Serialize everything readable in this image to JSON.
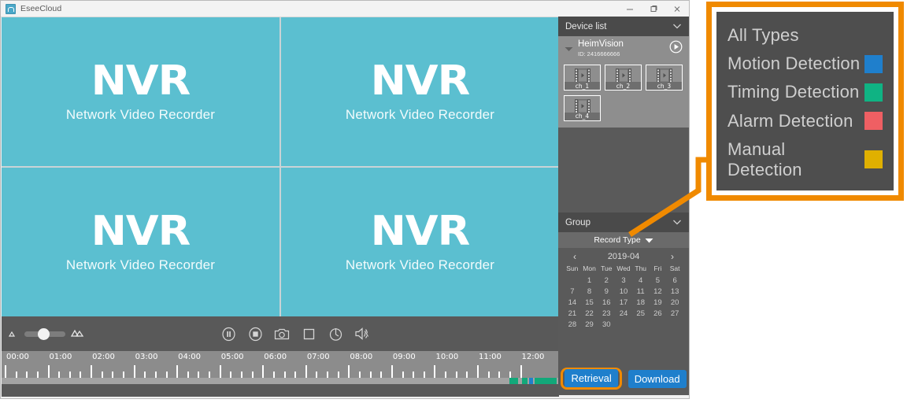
{
  "window": {
    "title": "EseeCloud",
    "icon": "app-icon",
    "controls": [
      {
        "name": "minimize-button",
        "glyph": "minimize-icon"
      },
      {
        "name": "maximize-button",
        "glyph": "maximize-icon"
      },
      {
        "name": "close-button",
        "glyph": "close-icon"
      }
    ]
  },
  "video_wall": {
    "panes": [
      {
        "logo": "NVR",
        "subtitle": "Network Video Recorder"
      },
      {
        "logo": "NVR",
        "subtitle": "Network Video Recorder"
      },
      {
        "logo": "NVR",
        "subtitle": "Network Video Recorder"
      },
      {
        "logo": "NVR",
        "subtitle": "Network Video Recorder"
      }
    ],
    "background_color": "#5bbfd0"
  },
  "control_bar": {
    "zoom_slider": {
      "min_icon": "small-image-icon",
      "max_icon": "large-image-icon",
      "value_percent": 33
    },
    "buttons": [
      {
        "name": "pause-button",
        "icon": "pause-icon"
      },
      {
        "name": "stop-button",
        "icon": "stop-icon"
      },
      {
        "name": "snapshot-button",
        "icon": "camera-icon"
      },
      {
        "name": "record-button",
        "icon": "square-icon"
      },
      {
        "name": "timer-button",
        "icon": "clock-icon"
      },
      {
        "name": "mute-button",
        "icon": "speaker-mute-icon"
      }
    ]
  },
  "timeline": {
    "hours": [
      "00:00",
      "01:00",
      "02:00",
      "03:00",
      "04:00",
      "05:00",
      "06:00",
      "07:00",
      "08:00",
      "09:00",
      "10:00",
      "11:00",
      "12:00"
    ],
    "segments": [
      {
        "start_percent": 91.1,
        "width_percent": 1.6,
        "color": "#12a87a"
      },
      {
        "start_percent": 93.4,
        "width_percent": 0.9,
        "color": "#12a87a"
      },
      {
        "start_percent": 94.7,
        "width_percent": 0.7,
        "color": "#1f7fcc"
      },
      {
        "start_percent": 95.6,
        "width_percent": 4.0,
        "color": "#12a87a"
      }
    ]
  },
  "sidebar": {
    "device_list": {
      "header": "Device list",
      "collapse_icon": "chevron-down-icon",
      "device": {
        "name": "HeimVision",
        "id": "ID: 2416666666",
        "expand_icon": "caret-down-icon",
        "play_icon": "play-circle-icon"
      },
      "channels": [
        {
          "label": "ch_1",
          "icon": "video-clip-icon"
        },
        {
          "label": "ch_2",
          "icon": "video-clip-icon"
        },
        {
          "label": "ch_3",
          "icon": "video-clip-icon"
        },
        {
          "label": "ch_4",
          "icon": "video-clip-icon"
        }
      ]
    },
    "group": {
      "header": "Group",
      "collapse_icon": "chevron-down-icon"
    },
    "record_type": {
      "label": "Record Type",
      "dropdown_icon": "triangle-down-icon"
    },
    "calendar": {
      "month": "2019-04",
      "prev_icon": "chevron-left-icon",
      "next_icon": "chevron-right-icon",
      "weekdays": [
        "Sun",
        "Mon",
        "Tue",
        "Wed",
        "Thu",
        "Fri",
        "Sat"
      ],
      "leading_blanks": 1,
      "days": [
        1,
        2,
        3,
        4,
        5,
        6,
        7,
        8,
        9,
        10,
        11,
        12,
        13,
        14,
        15,
        16,
        17,
        18,
        19,
        20,
        21,
        22,
        23,
        24,
        25,
        26,
        27,
        28,
        29,
        30
      ]
    },
    "actions": {
      "retrieval_label": "Retrieval",
      "download_label": "Download",
      "highlight_color": "#f08a00",
      "button_color": "#1f7fcc"
    }
  },
  "callout": {
    "border_color": "#f08a00",
    "items": [
      {
        "label": "All Types",
        "color": null
      },
      {
        "label": "Motion Detection",
        "color": "#1f7fcc"
      },
      {
        "label": "Timing Detection",
        "color": "#0fb383"
      },
      {
        "label": "Alarm Detection",
        "color": "#ef5f63"
      },
      {
        "label": "Manual Detection",
        "color": "#e0b000"
      }
    ]
  }
}
